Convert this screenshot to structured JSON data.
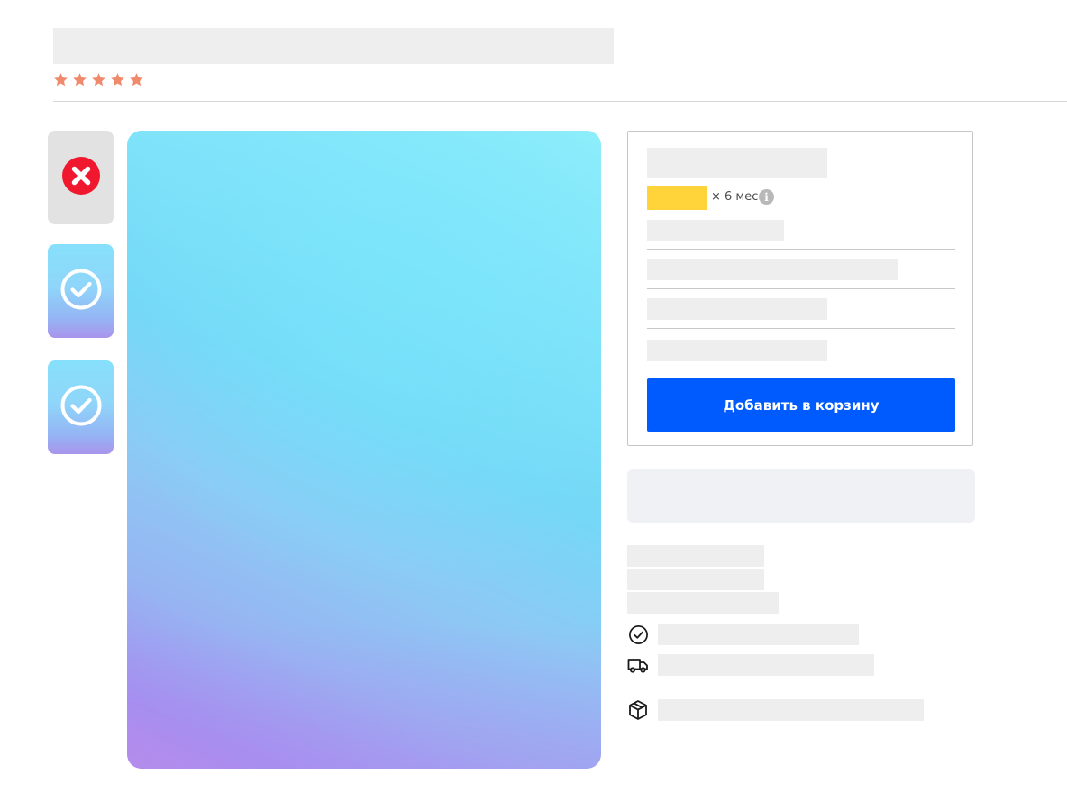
{
  "product": {
    "rating": {
      "stars": 5,
      "max": 5,
      "star_color": "#f08a6c"
    }
  },
  "gallery": {
    "thumbnails": [
      {
        "state": "rejected",
        "icon": "close-circle-icon",
        "icon_color": "#f0182e"
      },
      {
        "state": "approved",
        "icon": "check-circle-icon"
      },
      {
        "state": "approved",
        "icon": "check-circle-icon"
      }
    ]
  },
  "buy_box": {
    "installment_text": "× 6 мес",
    "installment_badge_color": "#ffd43a",
    "info_icon_label": "i",
    "cart_button_label": "Добавить в корзину",
    "cart_button_color": "#005bff"
  },
  "features": [
    {
      "icon": "check-circle-icon"
    },
    {
      "icon": "truck-icon"
    },
    {
      "icon": "box-icon"
    }
  ]
}
